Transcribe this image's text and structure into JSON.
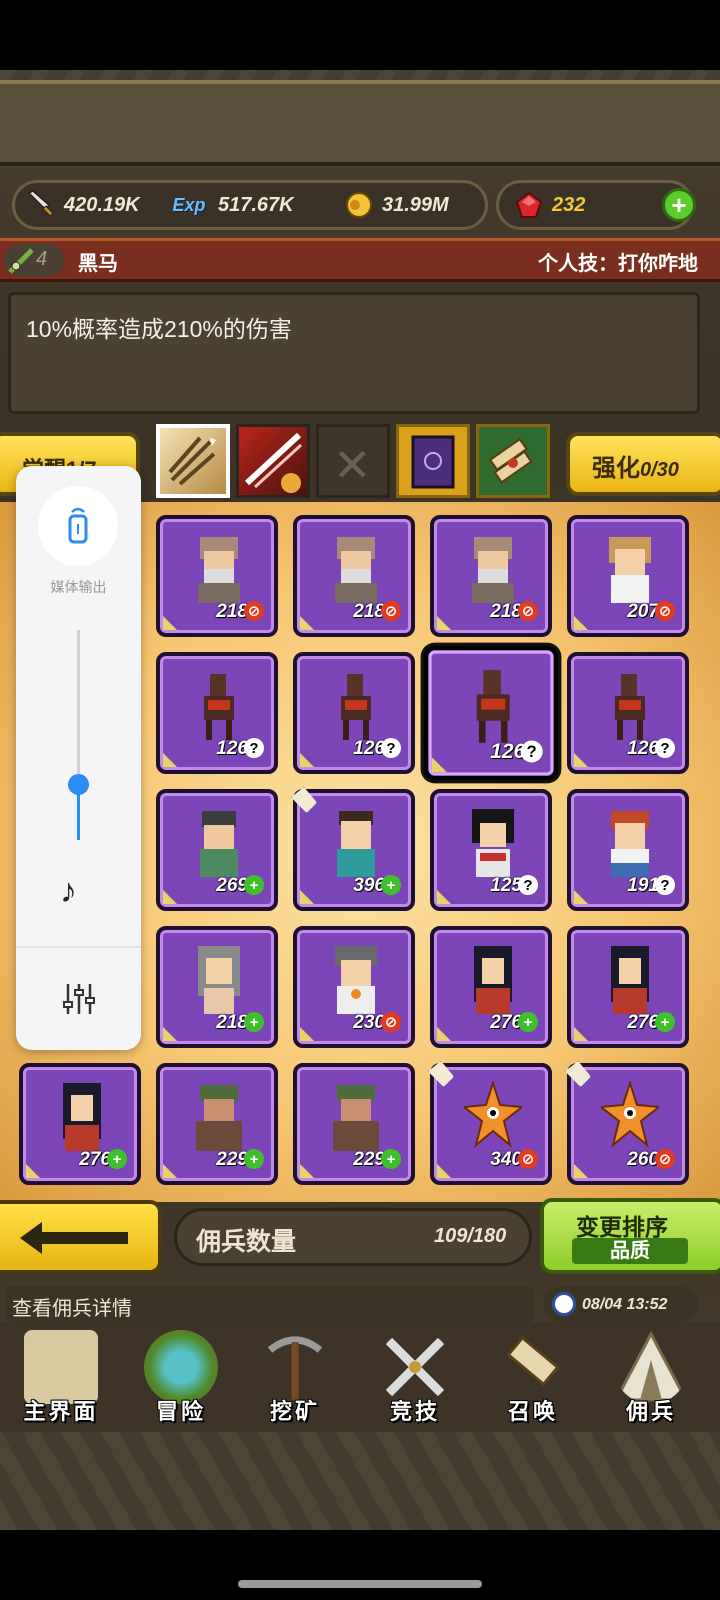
{
  "currency": {
    "attack": "420.19K",
    "exp_icon_text": "Exp",
    "exp": "517.67K",
    "gold": "31.99M",
    "ruby": "232"
  },
  "hero": {
    "level": "4",
    "name": "黑马",
    "skill": "个人技：打你咋地",
    "description": "10%概率造成210%的伤害"
  },
  "actions": {
    "awaken": "觉醒1/7",
    "enhance_label": "强化",
    "enhance_count": "0/30"
  },
  "skill_slots": [
    "triple-arrow-icon",
    "slash-handshake-icon",
    "empty-slot-icon",
    "spellbook-icon",
    "scroll-bundle-icon"
  ],
  "volume": {
    "output_label": "媒体输出",
    "level": 0.27
  },
  "mercenaries": [
    [
      {
        "level": "218",
        "badge": "red"
      },
      {
        "level": "218",
        "badge": "red"
      },
      {
        "level": "218",
        "badge": "red"
      },
      {
        "level": "207",
        "badge": "red"
      }
    ],
    [
      {
        "level": "126",
        "badge": "q"
      },
      {
        "level": "126",
        "badge": "q"
      },
      {
        "level": "126",
        "badge": "q"
      },
      {
        "level": "126",
        "badge": "q"
      }
    ],
    [
      {
        "level": "269",
        "badge": "g"
      },
      {
        "level": "396",
        "badge": "g"
      },
      {
        "level": "125",
        "badge": "q"
      },
      {
        "level": "191",
        "badge": "q"
      }
    ],
    [
      {
        "level": "218",
        "badge": "g"
      },
      {
        "level": "230",
        "badge": "red"
      },
      {
        "level": "276",
        "badge": "g"
      },
      {
        "level": "276",
        "badge": "g"
      }
    ],
    [
      {
        "level": "276",
        "badge": "g"
      },
      {
        "level": "229",
        "badge": "g"
      },
      {
        "level": "229",
        "badge": "g"
      },
      {
        "level": "340",
        "badge": "red"
      },
      {
        "level": "260",
        "badge": "red"
      }
    ]
  ],
  "roster": {
    "label": "佣兵数量",
    "count": "109/180"
  },
  "sort": {
    "title": "变更排序",
    "mode": "品质"
  },
  "tip": "查看佣兵详情",
  "clock": "08/04 13:52",
  "nav": [
    "主界面",
    "冒险",
    "挖矿",
    "竞技",
    "召唤",
    "佣兵"
  ],
  "colors": {
    "card_purple": "#7c46b8",
    "button_yellow": "#f2c93a",
    "button_green": "#8fcc2b",
    "hero_bar": "#7a2f1e",
    "volume_accent": "#2b8cf7"
  }
}
